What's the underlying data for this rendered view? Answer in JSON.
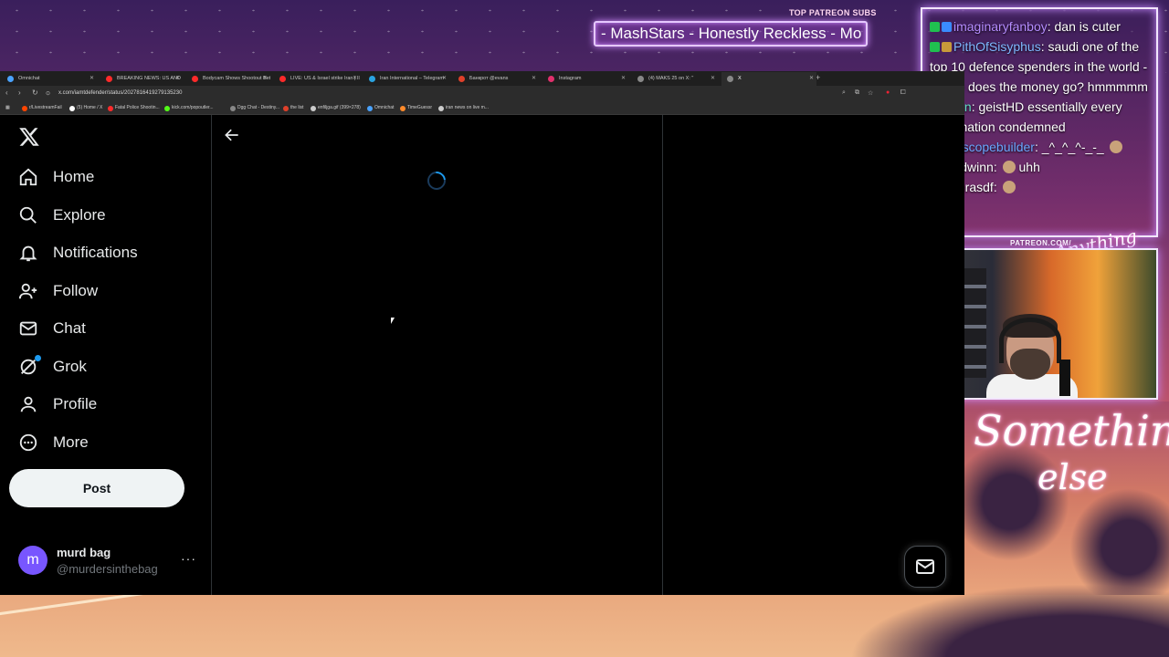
{
  "overlay": {
    "patreon_label": "TOP PATREON SUBS",
    "patreon_ticker": "- MashStars - Honestly Reckless - Mo",
    "patreon_url": "PATREON.COM/",
    "brand_script": "Anything else",
    "signature_line1": "Something",
    "signature_line2": "else"
  },
  "chat": [
    {
      "user": "imaginaryfanboy",
      "text": ": dan is cuter",
      "color": "#b58cff",
      "badges": [
        "#20c050",
        "#3a8cff"
      ]
    },
    {
      "user": "PithOfSisyphus",
      "text": ": saudi one of the top 10 defence spenders in the world - where does the money go? hmmmmm",
      "color": "#7fb8ff",
      "badges": [
        "#20c050",
        "#c89a3a"
      ]
    },
    {
      "user": "Eban",
      "text": ": geistHD essentially every Arab nation condemned",
      "color": "#5fe0c0",
      "badges": [
        "#6aa7ff"
      ]
    },
    {
      "user": "telescopebuilder",
      "text": ": _^_^_^-_-_ ",
      "color": "#6aa7ff",
      "badges": [
        "#6aa7ff"
      ]
    },
    {
      "user": "Kaldwinn",
      "text": ": ",
      "emote_after": " uhh",
      "color": "#ffffff",
      "badges": [
        "#6aa7ff"
      ]
    },
    {
      "user": "qwerasdf",
      "text": ": ",
      "color": "#ffffff",
      "badges": [
        "#6aa7ff"
      ]
    }
  ],
  "browser": {
    "tabs": [
      {
        "label": "Omnichat",
        "color": "#4aa3ff"
      },
      {
        "label": "BREAKING NEWS: US AND ISR",
        "color": "#ff2a2a"
      },
      {
        "label": "Bodycam Shows Shootout Betw",
        "color": "#ff2a2a"
      },
      {
        "label": "LIVE: US & Israel strike Iran | Il",
        "color": "#ff2a2a"
      },
      {
        "label": "Iran International – Telegram",
        "color": "#2aa3e0"
      },
      {
        "label": "Банкрот @evans",
        "color": "#e0402a"
      },
      {
        "label": "Instagram",
        "color": "#e1306c"
      },
      {
        "label": "(4) MAKS 25 on X: \"",
        "color": "#888888"
      },
      {
        "label": "X",
        "color": "#888888"
      }
    ],
    "url": "x.com/iamtdefender/status/2027816419279135230",
    "bookmarks": [
      {
        "label": "r/LivestreamFail",
        "color": "#ff4500"
      },
      {
        "label": "(5) Home / X",
        "color": "#ffffff"
      },
      {
        "label": "Fatal Police Shootin...",
        "color": "#ff2a2a"
      },
      {
        "label": "kick.com/popoutler...",
        "color": "#53fc18"
      },
      {
        "label": "Dgg Chat - Destiny...",
        "color": "#888888"
      },
      {
        "label": "the list",
        "color": "#e0402a"
      },
      {
        "label": "enfiljga.gif (399×278)",
        "color": "#cccccc"
      },
      {
        "label": "Omnichat",
        "color": "#4aa3ff"
      },
      {
        "label": "TimeGuessr",
        "color": "#ff8a2a"
      },
      {
        "label": "iran news on live m...",
        "color": "#cccccc"
      }
    ]
  },
  "x_app": {
    "nav": [
      {
        "label": "Home",
        "icon": "home-icon"
      },
      {
        "label": "Explore",
        "icon": "search-icon"
      },
      {
        "label": "Notifications",
        "icon": "bell-icon"
      },
      {
        "label": "Follow",
        "icon": "person-plus-icon"
      },
      {
        "label": "Chat",
        "icon": "mail-icon"
      },
      {
        "label": "Grok",
        "icon": "grok-icon"
      },
      {
        "label": "Profile",
        "icon": "person-icon"
      },
      {
        "label": "More",
        "icon": "more-circle-icon"
      }
    ],
    "post_label": "Post",
    "account_name": "murd bag",
    "account_handle": "@murdersinthebag",
    "avatar_letter": "m",
    "more_dots": "···",
    "accent": "#1d9bf0"
  }
}
